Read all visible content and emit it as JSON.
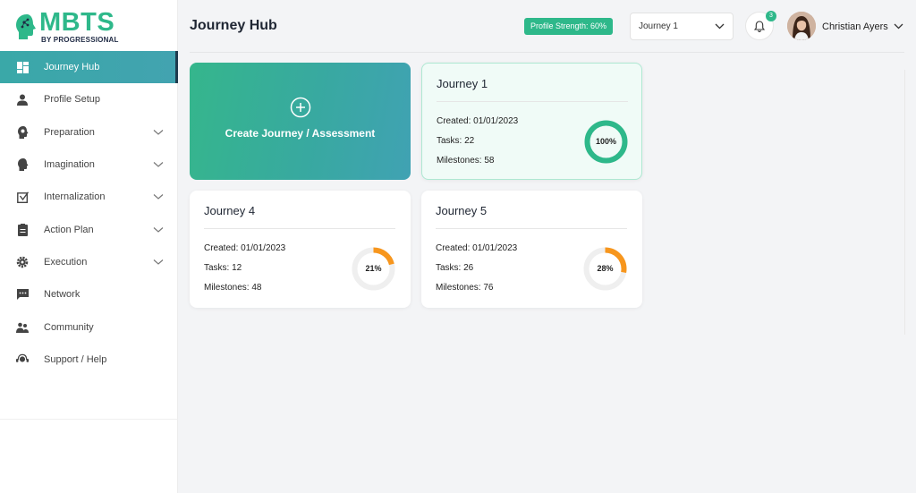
{
  "brand": {
    "title": "MBTS",
    "subtitle": "BY PROGRESSIONAL",
    "green": "#2eb88a",
    "teal": "#3aa8a8"
  },
  "sidebar": {
    "items": [
      {
        "label": "Journey Hub",
        "icon": "dashboard-icon",
        "active": true,
        "expandable": false
      },
      {
        "label": "Profile Setup",
        "icon": "user-icon",
        "active": false,
        "expandable": false
      },
      {
        "label": "Preparation",
        "icon": "head-bulb-icon",
        "active": false,
        "expandable": true
      },
      {
        "label": "Imagination",
        "icon": "head-gear-icon",
        "active": false,
        "expandable": true
      },
      {
        "label": "Internalization",
        "icon": "checkbox-arrow-icon",
        "active": false,
        "expandable": true
      },
      {
        "label": "Action Plan",
        "icon": "clipboard-icon",
        "active": false,
        "expandable": true
      },
      {
        "label": "Execution",
        "icon": "gear-icon",
        "active": false,
        "expandable": true
      },
      {
        "label": "Network",
        "icon": "chat-icon",
        "active": false,
        "expandable": false
      },
      {
        "label": "Community",
        "icon": "people-icon",
        "active": false,
        "expandable": false
      },
      {
        "label": "Support / Help",
        "icon": "headset-icon",
        "active": false,
        "expandable": false
      }
    ]
  },
  "header": {
    "title": "Journey Hub",
    "profile_strength": "Profile Strength: 60%",
    "journey_select": "Journey 1",
    "notification_count": "3",
    "user_name": "Christian Ayers"
  },
  "create_card": {
    "label": "Create Journey / Assessment"
  },
  "labels": {
    "created": "Created:",
    "tasks": "Tasks:",
    "milestones": "Milestones:"
  },
  "journeys": [
    {
      "title": "Journey 1",
      "created": "01/01/2023",
      "tasks": "22",
      "milestones": "58",
      "progress": 100,
      "progress_label": "100%",
      "ring_color": "#2eb88a"
    },
    {
      "title": "Journey 4",
      "created": "01/01/2023",
      "tasks": "12",
      "milestones": "48",
      "progress": 21,
      "progress_label": "21%",
      "ring_color": "#f7961d"
    },
    {
      "title": "Journey 5",
      "created": "01/01/2023",
      "tasks": "26",
      "milestones": "76",
      "progress": 28,
      "progress_label": "28%",
      "ring_color": "#f7961d"
    }
  ]
}
